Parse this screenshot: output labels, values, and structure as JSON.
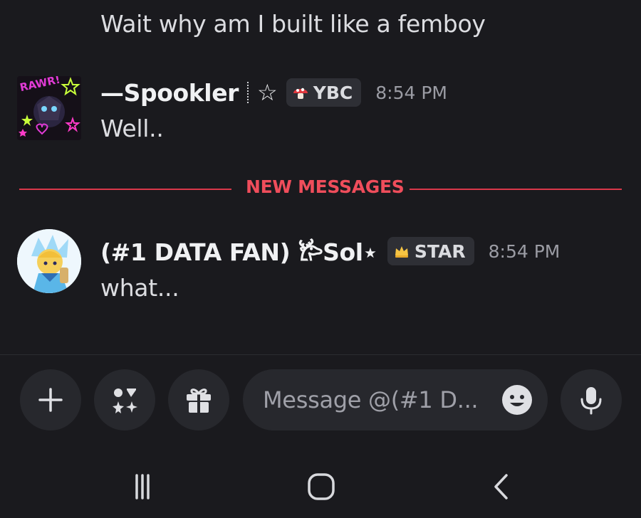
{
  "messages": {
    "continued_text": "Wait why am I built like a femboy",
    "first": {
      "username": "—Spookler",
      "badge_icon": "star-outline-icon",
      "tag_label": "YBC",
      "tag_icon": "mushroom-icon",
      "timestamp": "8:54 PM",
      "text": "Well.."
    },
    "divider_label": "NEW MESSAGES",
    "second": {
      "username": "(#1 DATA FAN) 𐂂Sol⋆",
      "tag_label": "STAR",
      "tag_icon": "crown-icon",
      "timestamp": "8:54 PM",
      "text": "what..."
    }
  },
  "composer": {
    "placeholder": "Message @(#1 D...",
    "buttons": [
      "plus-icon",
      "apps-icon",
      "gift-icon",
      "microphone-icon"
    ],
    "emoji_icon": "emoji-icon"
  },
  "navbar": {
    "icons": [
      "recents-icon",
      "home-icon",
      "back-icon"
    ]
  },
  "colors": {
    "background": "#1a1a1e",
    "surface": "#27282d",
    "new_messages": "#ef4d5b",
    "timestamp": "#9b9ca4"
  }
}
